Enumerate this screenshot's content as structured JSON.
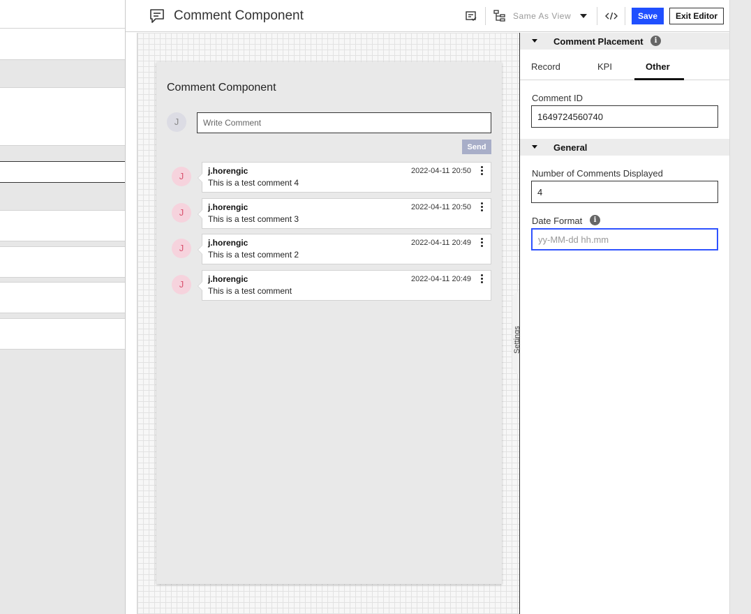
{
  "header": {
    "title": "Comment Component",
    "view_select": "Same As View",
    "save_label": "Save",
    "exit_label": "Exit Editor"
  },
  "component": {
    "title": "Comment Component",
    "current_user_initial": "J",
    "input_placeholder": "Write Comment",
    "send_label": "Send",
    "comments": [
      {
        "initial": "J",
        "author": "j.horengic",
        "date": "2022-04-11 20:50",
        "text": "This is a test comment 4"
      },
      {
        "initial": "J",
        "author": "j.horengic",
        "date": "2022-04-11 20:50",
        "text": "This is a test comment 3"
      },
      {
        "initial": "J",
        "author": "j.horengic",
        "date": "2022-04-11 20:49",
        "text": "This is a test comment 2"
      },
      {
        "initial": "J",
        "author": "j.horengic",
        "date": "2022-04-11 20:49",
        "text": "This is a test comment"
      }
    ]
  },
  "settings_tab_label": "Settings",
  "panel": {
    "placement_section": "Comment Placement",
    "tabs": [
      "Record",
      "KPI",
      "Other"
    ],
    "active_tab": "Other",
    "comment_id_label": "Comment ID",
    "comment_id_value": "1649724560740",
    "general_section": "General",
    "num_comments_label": "Number of Comments Displayed",
    "num_comments_value": "4",
    "date_format_label": "Date Format",
    "date_format_placeholder": "yy-MM-dd hh.mm"
  },
  "colors": {
    "primary": "#1f4fff",
    "send_disabled": "#a8aec8",
    "avatar_bg": "#f6d3dd",
    "avatar_text": "#d9536f"
  }
}
